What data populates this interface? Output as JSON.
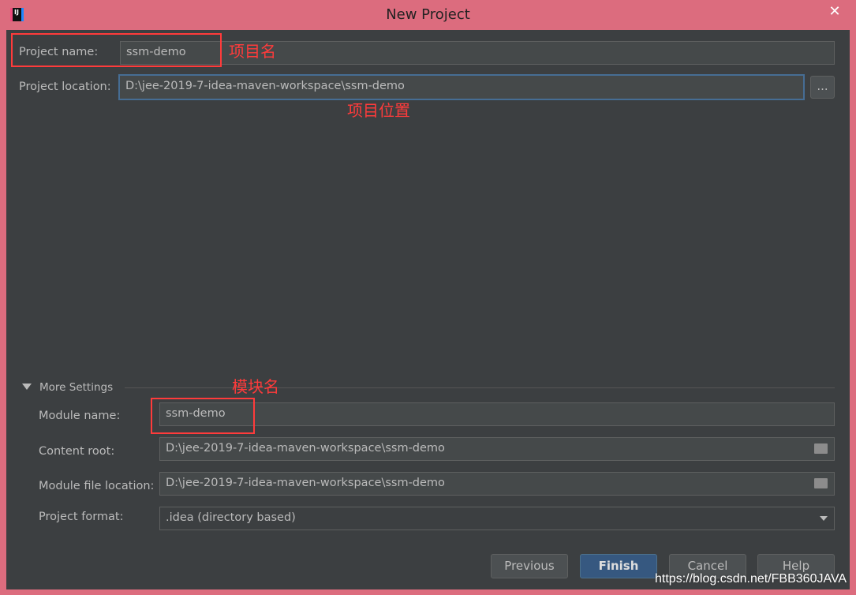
{
  "window": {
    "title": "New Project",
    "app_icon": "intellij-icon",
    "close_icon": "close-icon"
  },
  "project": {
    "name_label": "Project name:",
    "name_value": "ssm-demo",
    "location_label": "Project location:",
    "location_value": "D:\\jee-2019-7-idea-maven-workspace\\ssm-demo",
    "browse_label": "..."
  },
  "annotations": {
    "project_name": "项目名",
    "project_location": "项目位置",
    "module_name": "模块名",
    "color": "#ff3b3b"
  },
  "more_settings": {
    "label": "More Settings",
    "module_name_label": "Module name:",
    "module_name_value": "ssm-demo",
    "content_root_label": "Content root:",
    "content_root_value": "D:\\jee-2019-7-idea-maven-workspace\\ssm-demo",
    "module_file_label": "Module file location:",
    "module_file_value": "D:\\jee-2019-7-idea-maven-workspace\\ssm-demo",
    "format_label": "Project format:",
    "format_value": ".idea (directory based)"
  },
  "buttons": {
    "previous": "Previous",
    "finish": "Finish",
    "cancel": "Cancel",
    "help": "Help"
  },
  "watermark": "https://blog.csdn.net/FBB360JAVA"
}
